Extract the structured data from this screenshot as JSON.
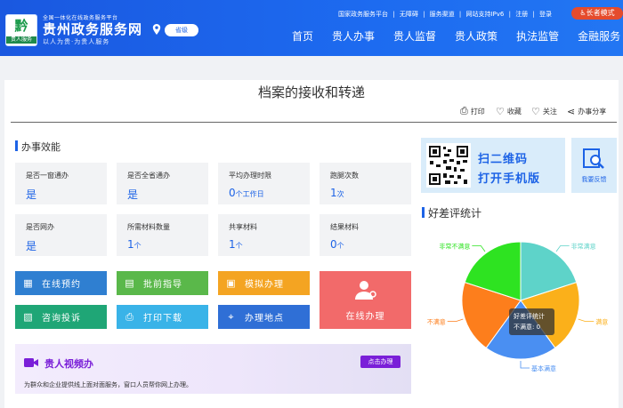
{
  "header": {
    "logo_text": "贵人服务",
    "platform_small": "全国一体化在线政务服务平台",
    "site_name": "贵州政务服务网",
    "slogan": "以人为贵·为贵人服务",
    "location": "省级",
    "top_links": [
      "国家政务服务平台",
      "|",
      "无障碍",
      "|",
      "服务渠道",
      "|",
      "网站支持IPv6",
      "|",
      "注册",
      "|",
      "登录"
    ],
    "elder_mode": "长者模式",
    "nav": [
      "首页",
      "贵人办事",
      "贵人监督",
      "贵人政策",
      "执法监管",
      "金融服务"
    ]
  },
  "page": {
    "title": "档案的接收和转递",
    "tools": {
      "print": "打印",
      "favorite": "收藏",
      "follow": "关注",
      "share": "办事分享"
    }
  },
  "efficiency": {
    "title": "办事效能",
    "tiles": [
      {
        "label": "是否一窗通办",
        "value": "是",
        "unit": ""
      },
      {
        "label": "是否全省通办",
        "value": "是",
        "unit": ""
      },
      {
        "label": "平均办理时限",
        "value": "0",
        "unit": "个工作日"
      },
      {
        "label": "跑腿次数",
        "value": "1",
        "unit": "次"
      },
      {
        "label": "是否网办",
        "value": "是",
        "unit": ""
      },
      {
        "label": "所需材料数量",
        "value": "1",
        "unit": "个"
      },
      {
        "label": "共享材料",
        "value": "1",
        "unit": "个"
      },
      {
        "label": "结果材料",
        "value": "0",
        "unit": "个"
      }
    ]
  },
  "actions": {
    "reserve": "在线预约",
    "guide": "批前指导",
    "simulate": "模拟办理",
    "consult": "咨询投诉",
    "print": "打印下载",
    "location": "办理地点",
    "online": "在线办理"
  },
  "video": {
    "title": "贵人视频办",
    "desc": "为群众和企业提供线上面对面服务，窗口人员帮你网上办理。",
    "button": "点击办理"
  },
  "mobile": {
    "line1": "扫二维码",
    "line2": "打开手机版"
  },
  "feedback": {
    "label": "我要反馈"
  },
  "rating": {
    "title": "好差评统计",
    "tooltip_title": "好差评统计",
    "tooltip_value": "不满意: 0"
  },
  "chart_data": {
    "type": "pie",
    "title": "好差评统计",
    "categories": [
      "非常满意",
      "满意",
      "基本满意",
      "不满意",
      "非常不满意"
    ],
    "values": [
      1,
      1,
      1,
      1,
      1
    ],
    "colors": [
      "#5ed3c9",
      "#fbb01a",
      "#4a8ff2",
      "#fd7e1c",
      "#2ee321"
    ]
  }
}
